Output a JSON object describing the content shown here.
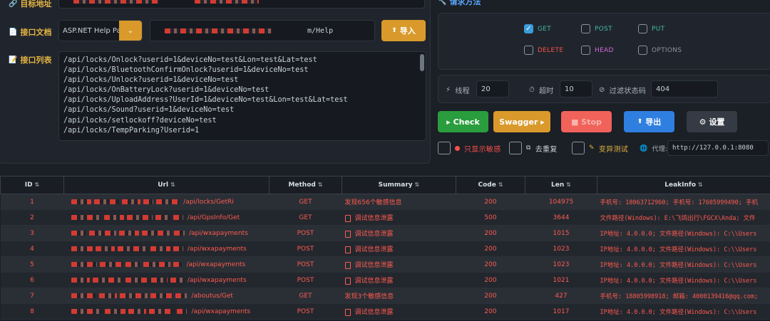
{
  "labels": {
    "target": "目标地址",
    "doc": "接口文档",
    "list": "接口列表",
    "method": "请求方法"
  },
  "doc_type": "ASP.NET Help Pag",
  "doc_url_suffix": "m/Help",
  "import_label": "导入",
  "api_list": [
    "/api/locks/Onlock?userid=1&deviceNo=test&Lon=test&Lat=test",
    "/api/locks/BluetoothConfirmOnlock?userid=1&deviceNo=test",
    "/api/locks/Unlock?userid=1&deviceNo=test",
    "/api/locks/OnBatteryLock?userid=1&deviceNo=test",
    "/api/locks/UploadAddress?UserId=1&deviceNo=test&Lon=test&Lat=test",
    "/api/locks/Sound?userid=1&deviceNo=test",
    "/api/locks/setlockoff?deviceNo=test",
    "/api/locks/TempParking?Userid=1"
  ],
  "methods": [
    {
      "label": "GET",
      "checked": true,
      "color": "#3fb9a5"
    },
    {
      "label": "POST",
      "checked": false,
      "color": "#3fb9a5"
    },
    {
      "label": "PUT",
      "checked": false,
      "color": "#3fb9a5"
    },
    {
      "label": "DELETE",
      "checked": false,
      "color": "#f85149"
    },
    {
      "label": "HEAD",
      "checked": false,
      "color": "#d36ad6"
    },
    {
      "label": "OPTIONS",
      "checked": false,
      "color": "#8b949e"
    }
  ],
  "params": {
    "threads_label": "线程",
    "threads": "20",
    "timeout_label": "超时",
    "timeout": "10",
    "filter_label": "过滤状态码",
    "filter": "404"
  },
  "buttons": {
    "check": "▸ Check",
    "swagger": "Swagger ▸",
    "stop": "■ Stop",
    "export": "导出",
    "settings": "设置"
  },
  "options": {
    "sensitive_only": "只显示敏感",
    "dedupe": "去重复",
    "mutation": "变异测试",
    "proxy_label": "代理:",
    "proxy": "http://127.0.0.1:8080"
  },
  "table": {
    "headers": [
      "ID",
      "Url",
      "Method",
      "Summary",
      "Code",
      "Len",
      "LeakInfo"
    ],
    "rows": [
      {
        "id": "1",
        "url": "/api/locks/GetRi",
        "method": "GET",
        "summary": "发现656个敏感信息",
        "doc": false,
        "code": "200",
        "len": "104975",
        "leak": "手机号: 18063712960; 手机号: 17605999490; 手机"
      },
      {
        "id": "2",
        "url": "/api/GpsInfo/Get",
        "method": "GET",
        "summary": "调试信息泄露",
        "doc": true,
        "code": "500",
        "len": "3644",
        "leak": "文件路径(Windows): E:\\飞鸽出行\\FGCX\\Anda; 文件"
      },
      {
        "id": "3",
        "url": "/api/wxapayments",
        "method": "POST",
        "summary": "调试信息泄露",
        "doc": true,
        "code": "200",
        "len": "1015",
        "leak": "IP地址: 4.0.0.0; 文件路径(Windows): C:\\\\Users"
      },
      {
        "id": "4",
        "url": "/api/wxapayments",
        "method": "POST",
        "summary": "调试信息泄露",
        "doc": true,
        "code": "200",
        "len": "1023",
        "leak": "IP地址: 4.0.0.0; 文件路径(Windows): C:\\\\Users"
      },
      {
        "id": "5",
        "url": "/api/wxapayments",
        "method": "POST",
        "summary": "调试信息泄露",
        "doc": true,
        "code": "200",
        "len": "1023",
        "leak": "IP地址: 4.0.0.0; 文件路径(Windows): C:\\\\Users"
      },
      {
        "id": "6",
        "url": "/api/wxapayments",
        "method": "POST",
        "summary": "调试信息泄露",
        "doc": true,
        "code": "200",
        "len": "1021",
        "leak": "IP地址: 4.0.0.0; 文件路径(Windows): C:\\\\Users"
      },
      {
        "id": "7",
        "url": "/aboutus/Get",
        "method": "GET",
        "summary": "发现3个敏感信息",
        "doc": false,
        "code": "200",
        "len": "427",
        "leak": "手机号: 18805998918; 邮箱: 4000139416@qq.com;"
      },
      {
        "id": "8",
        "url": "/api/wxapayments",
        "method": "POST",
        "summary": "调试信息泄露",
        "doc": true,
        "code": "200",
        "len": "1017",
        "leak": "IP地址: 4.0.0.0; 文件路径(Windows): C:\\\\Users"
      }
    ]
  }
}
